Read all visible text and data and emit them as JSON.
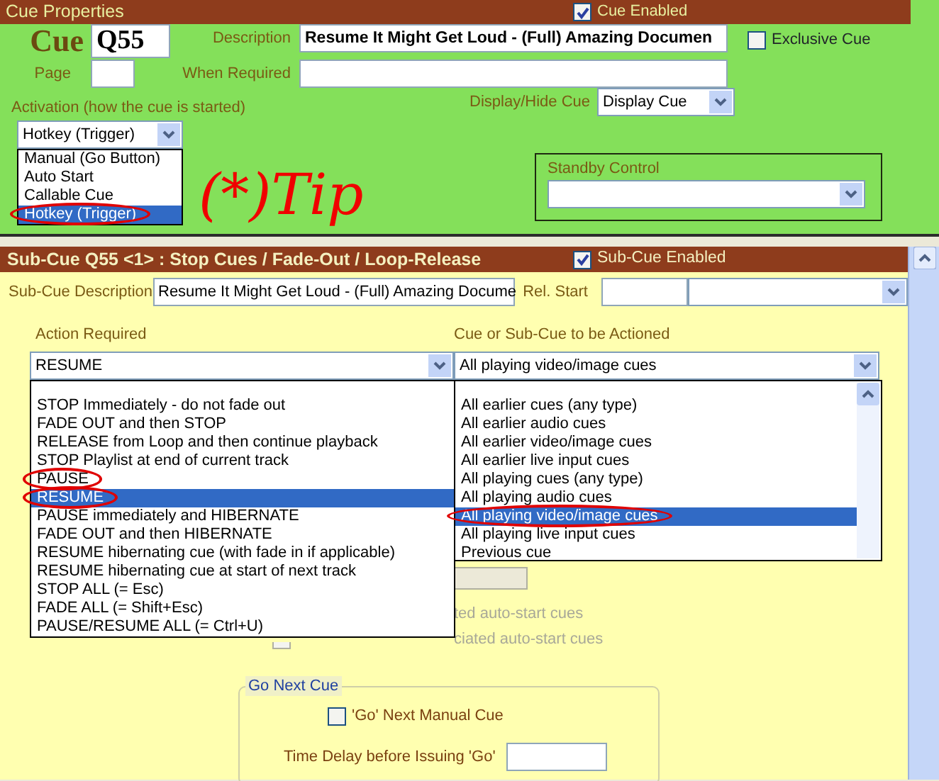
{
  "cue_properties": {
    "title": "Cue Properties",
    "cue_enabled": {
      "label": "Cue Enabled",
      "checked": true
    },
    "cue_label": "Cue",
    "cue_value": "Q55",
    "page_label": "Page",
    "description_label": "Description",
    "description_value": "Resume It Might Get Loud - (Full) Amazing Documen",
    "when_required_label": "When Required",
    "exclusive_cue": {
      "label": "Exclusive Cue",
      "checked": false
    },
    "display_hide_label": "Display/Hide Cue",
    "display_hide_value": "Display Cue",
    "activation_label": "Activation (how the cue is started)",
    "activation_value": "Hotkey (Trigger)",
    "activation_options": [
      {
        "label": "Manual (Go Button)",
        "selected": false,
        "circled": false
      },
      {
        "label": "Auto Start",
        "selected": false,
        "circled": false
      },
      {
        "label": "Callable Cue",
        "selected": false,
        "circled": false
      },
      {
        "label": "Hotkey (Trigger)",
        "selected": true,
        "circled": true
      }
    ],
    "standby_label": "Standby Control"
  },
  "annotation": {
    "text": "(*)Tip"
  },
  "sub_cue": {
    "title": "Sub-Cue Q55 <1> : Stop Cues / Fade-Out / Loop-Release",
    "enabled": {
      "label": "Sub-Cue Enabled",
      "checked": true
    },
    "description_label": "Sub-Cue Description",
    "description_value": "Resume It Might Get Loud - (Full) Amazing Docume",
    "rel_start_label": "Rel. Start",
    "action_label": "Action Required",
    "action_value": "RESUME",
    "target_label": "Cue or Sub-Cue to be Actioned",
    "target_value": "All playing video/image cues",
    "action_options": [
      {
        "label": "STOP Immediately - do not fade out",
        "selected": false,
        "circled": false
      },
      {
        "label": "FADE OUT and then STOP",
        "selected": false,
        "circled": false
      },
      {
        "label": "RELEASE from Loop and then continue playback",
        "selected": false,
        "circled": false
      },
      {
        "label": "STOP Playlist at end of current track",
        "selected": false,
        "circled": false
      },
      {
        "label": "PAUSE",
        "selected": false,
        "circled": true
      },
      {
        "label": "RESUME",
        "selected": true,
        "circled": true
      },
      {
        "label": "PAUSE immediately and HIBERNATE",
        "selected": false,
        "circled": false
      },
      {
        "label": "FADE OUT and then HIBERNATE",
        "selected": false,
        "circled": false
      },
      {
        "label": "RESUME hibernating cue (with fade in if applicable)",
        "selected": false,
        "circled": false
      },
      {
        "label": "RESUME hibernating cue at start of next track",
        "selected": false,
        "circled": false
      },
      {
        "label": "STOP ALL (= Esc)",
        "selected": false,
        "circled": false
      },
      {
        "label": "FADE ALL (= Shift+Esc)",
        "selected": false,
        "circled": false
      },
      {
        "label": "PAUSE/RESUME ALL (= Ctrl+U)",
        "selected": false,
        "circled": false
      }
    ],
    "target_options": [
      {
        "label": "All earlier cues (any type)",
        "selected": false,
        "circled": false
      },
      {
        "label": "All earlier audio cues",
        "selected": false,
        "circled": false
      },
      {
        "label": "All earlier video/image cues",
        "selected": false,
        "circled": false
      },
      {
        "label": "All earlier live input cues",
        "selected": false,
        "circled": false
      },
      {
        "label": "All playing cues (any type)",
        "selected": false,
        "circled": false
      },
      {
        "label": "All playing audio cues",
        "selected": false,
        "circled": false
      },
      {
        "label": "All playing video/image cues",
        "selected": true,
        "circled": true
      },
      {
        "label": "All playing live input cues",
        "selected": false,
        "circled": false
      },
      {
        "label": "Previous cue",
        "selected": false,
        "circled": false
      }
    ],
    "hidden_rows": [
      {
        "text": "ted auto-start cues"
      },
      {
        "text": "ciated auto-start cues",
        "checked": false
      }
    ],
    "go_next": {
      "legend": "Go Next Cue",
      "checkbox": {
        "label": "'Go' Next Manual Cue",
        "checked": false
      },
      "delay_label": "Time Delay before Issuing 'Go'"
    }
  }
}
